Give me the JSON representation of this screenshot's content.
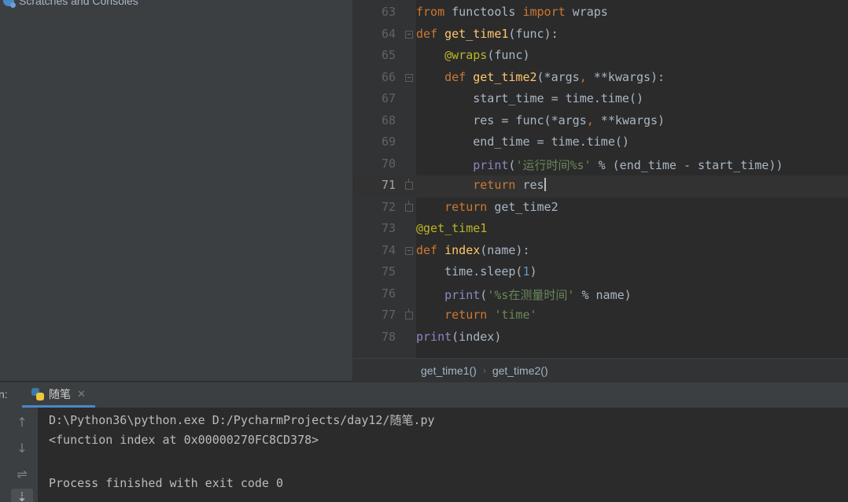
{
  "project_panel": {
    "scratches_label": "Scratches and Consoles"
  },
  "editor": {
    "current_line": "71",
    "lines": [
      {
        "num": "63",
        "code": "from functools import wraps"
      },
      {
        "num": "64",
        "code": "def get_time1(func):"
      },
      {
        "num": "65",
        "code": "    @wraps(func)"
      },
      {
        "num": "66",
        "code": "    def get_time2(*args, **kwargs):"
      },
      {
        "num": "67",
        "code": "        start_time = time.time()"
      },
      {
        "num": "68",
        "code": "        res = func(*args, **kwargs)"
      },
      {
        "num": "69",
        "code": "        end_time = time.time()"
      },
      {
        "num": "70",
        "code": "        print('运行时间%s' % (end_time - start_time))"
      },
      {
        "num": "71",
        "code": "        return res"
      },
      {
        "num": "72",
        "code": "    return get_time2"
      },
      {
        "num": "73",
        "code": "@get_time1"
      },
      {
        "num": "74",
        "code": "def index(name):"
      },
      {
        "num": "75",
        "code": "    time.sleep(1)"
      },
      {
        "num": "76",
        "code": "    print('%s在测量时间' % name)"
      },
      {
        "num": "77",
        "code": "    return 'time'"
      },
      {
        "num": "78",
        "code": "print(index)"
      }
    ]
  },
  "breadcrumb": {
    "items": [
      "get_time1()",
      "get_time2()"
    ]
  },
  "run_panel": {
    "label": "n:",
    "tab_label": "随笔",
    "close_glyph": "✕",
    "toolbar": {
      "up_glyph": "↑",
      "down_glyph": "↓",
      "wrap_glyph": "⇌",
      "scroll_end_glyph": "⇣"
    },
    "console_lines": [
      "D:\\Python36\\python.exe D:/PycharmProjects/day12/随笔.py",
      "<function index at 0x00000270FC8CD378>",
      "",
      "Process finished with exit code 0"
    ]
  },
  "colors": {
    "keyword": "#cc7832",
    "function": "#ffc66d",
    "decorator": "#bbb529",
    "string": "#6a8759",
    "number": "#6897bb",
    "builtin": "#8888c6",
    "text": "#a9b7c6",
    "background": "#2b2b2b",
    "panel": "#3c3f41",
    "accent": "#4a88c7"
  },
  "icons": {
    "scratches": "scratches-icon",
    "python_file": "python-icon",
    "fold": "fold-marker-icon"
  }
}
